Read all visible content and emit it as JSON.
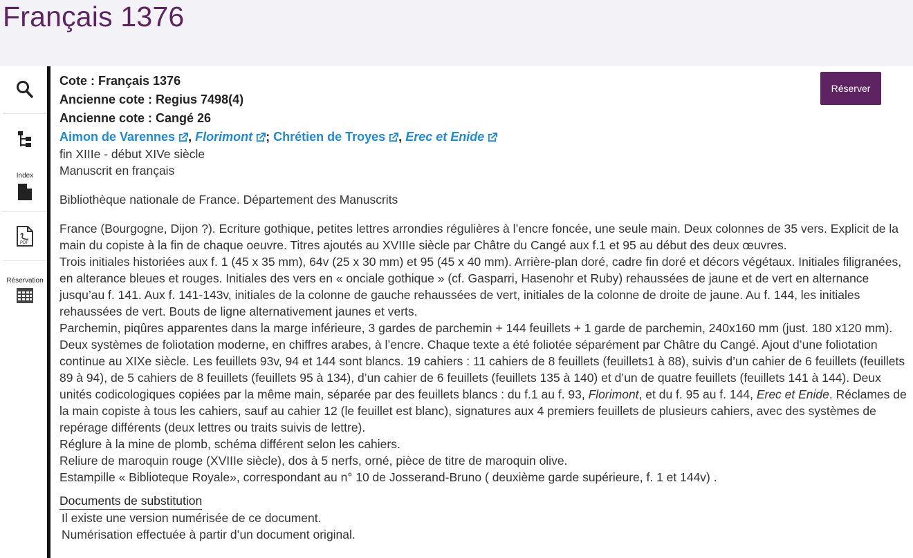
{
  "page": {
    "title": "Français 1376"
  },
  "sidebar": {
    "index_label": "Index",
    "reservation_label": "Réservation"
  },
  "record": {
    "cote": "Cote : Français 1376",
    "ancienne_cote_1": "Ancienne cote : Regius 7498(4)",
    "ancienne_cote_2": "Ancienne cote : Cangé 26",
    "authors": [
      {
        "text": "Aimon de Varennes",
        "italic": false
      },
      {
        "text": "Florimont",
        "italic": true
      },
      {
        "text": "Chrétien de Troyes",
        "italic": false
      },
      {
        "text": "Erec et Enide",
        "italic": true
      }
    ],
    "sep_comma": ",",
    "sep_semicolon": ";",
    "date": "fin XIIIe - début XIVe siècle",
    "language": "Manuscrit en français",
    "institution": "Bibliothèque nationale de France. Département des Manuscrits",
    "desc1": "France (Bourgogne, Dijon ?). Ecriture gothique, petites lettres arrondies régulières à l’encre foncée, une seule main. Deux colonnes de 35 vers. Explicit de la main du copiste à la fin de chaque oeuvre. Titres ajoutés au XVIIIe siècle par Châtre du Cangé aux f.1 et 95 au début des deux œuvres.",
    "desc2": "Trois initiales historiées aux f. 1 (45 x 35 mm), 64v (25 x 30 mm) et 95 (45 x 40 mm). Arrière-plan doré, cadre fin doré et décors végétaux. Initiales filigranées, en alterance bleues et rouges. Initiales des vers en « onciale gothique » (cf. Gasparri, Hasenohr et Ruby) rehaussées de jaune et de vert en alternance jusqu’au f. 141. Aux f. 141-143v, initiales de la colonne de gauche rehaussées de vert, initiales de la colonne de droite de jaune. Au f. 144, les initiales rehaussées de vert. Bouts de ligne alternativement jaunes et verts.",
    "desc3": "Parchemin, piqûres apparentes dans la marge inférieure, 3 gardes de parchemin + 144 feuillets + 1 garde de parchemin, 240x160 mm (just. 180 x120 mm).",
    "desc4_a": "Deux systèmes de foliotation moderne, en chiffres arabes, à l’encre. Chaque texte a été foliotée séparément par Châtre du Cangé. Ajout d’une foliotation continue au XIXe siècle. Les feuillets 93v, 94 et 144 sont blancs. 19 cahiers : 11 cahiers de 8 feuillets (feuillets1 à 88), suivis d’un cahier de 6 feuillets (feuillets 89 à 94), de 5 cahiers de 8 feuillets (feuillets 95 à 134), d’un cahier de 6 feuillets (feuillets 135 à 140) et d’un de quatre feuillets (feuillets 141 à 144). Deux unités codicologiques copiées par la même main, séparée par des feuillets blancs : du f.1 au f. 93, ",
    "desc4_i1": "Florimont",
    "desc4_b": ", et du f. 95 au f. 144, ",
    "desc4_i2": "Erec et Enide",
    "desc4_c": ". Réclames de la main copiste à tous les cahiers, sauf au cahier 12 (le feuillet est blanc), signatures aux 4 premiers feuillets de plusieurs cahiers, avec des systèmes de repérage différents (deux lettres ou traits suivis de lettre).",
    "desc5": "Réglure à la mine de plomb, schéma différent selon les cahiers.",
    "desc6": "Reliure de maroquin rouge (XVIIIe siècle), dos à 5 nerfs, orné, pièce de titre de maroquin olive.",
    "desc7": "Estampille « Biblioteque Royale», correspondant au n° 10 de Josserand-Bruno ( deuxième garde supérieure, f. 1 et 144v) .",
    "subst_heading": "Documents de substitution",
    "subst_1": "Il existe une version numérisée de ce document.",
    "subst_2": "Numérisation effectuée à partir d’un document original."
  },
  "actions": {
    "reserve_label": "Réserver"
  },
  "colors": {
    "brand": "#5e2461",
    "link": "#1f8ad6"
  }
}
